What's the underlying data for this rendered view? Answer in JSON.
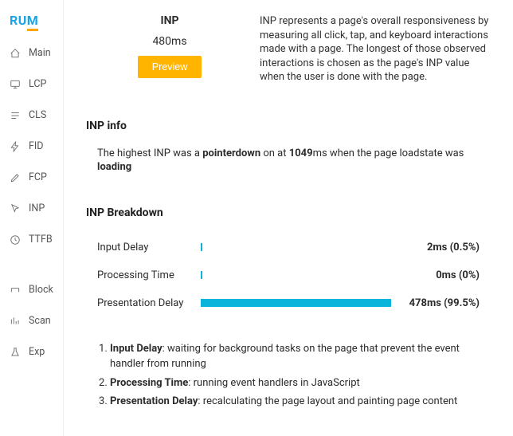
{
  "logo": "RUM",
  "sidebar": {
    "items": [
      {
        "label": "Main"
      },
      {
        "label": "LCP"
      },
      {
        "label": "CLS"
      },
      {
        "label": "FID"
      },
      {
        "label": "FCP"
      },
      {
        "label": "INP"
      },
      {
        "label": "TTFB"
      },
      {
        "label": "Block"
      },
      {
        "label": "Scan"
      },
      {
        "label": "Exp"
      }
    ]
  },
  "header": {
    "metric_name": "INP",
    "metric_value": "480ms",
    "rating_label": "Preview",
    "desc": "INP represents a page's overall responsiveness by measuring all click, tap, and keyboard interactions made with a page. The longest of those observed interactions is chosen as the page's INP value when the user is done with the page."
  },
  "info": {
    "heading": "INP info",
    "t1": "The highest INP was a ",
    "event": "pointerdown",
    "t2": " on at ",
    "time": "1049",
    "t3": "ms when the page loadstate was ",
    "state": "loading"
  },
  "breakdown": {
    "heading": "INP Breakdown",
    "rows": [
      {
        "label": "Input Delay",
        "value": "2ms (0.5%)",
        "pct": 0.5
      },
      {
        "label": "Processing Time",
        "value": "0ms (0%)",
        "pct": 0
      },
      {
        "label": "Presentation Delay",
        "value": "478ms (99.5%)",
        "pct": 99.5
      }
    ]
  },
  "defs": {
    "l1": "Input Delay",
    "d1": ": waiting for background tasks on the page that prevent the event handler from running",
    "l2": "Processing Time",
    "d2": ": running event handlers in JavaScript",
    "l3": "Presentation Delay",
    "d3": ": recalculating the page layout and painting page content"
  },
  "chart_data": {
    "type": "bar",
    "title": "INP Breakdown",
    "categories": [
      "Input Delay",
      "Processing Time",
      "Presentation Delay"
    ],
    "values": [
      2,
      0,
      478
    ],
    "series": [
      {
        "name": "ms",
        "values": [
          2,
          0,
          478
        ]
      },
      {
        "name": "pct",
        "values": [
          0.5,
          0,
          99.5
        ]
      }
    ],
    "xlabel": "",
    "ylabel": "ms"
  }
}
